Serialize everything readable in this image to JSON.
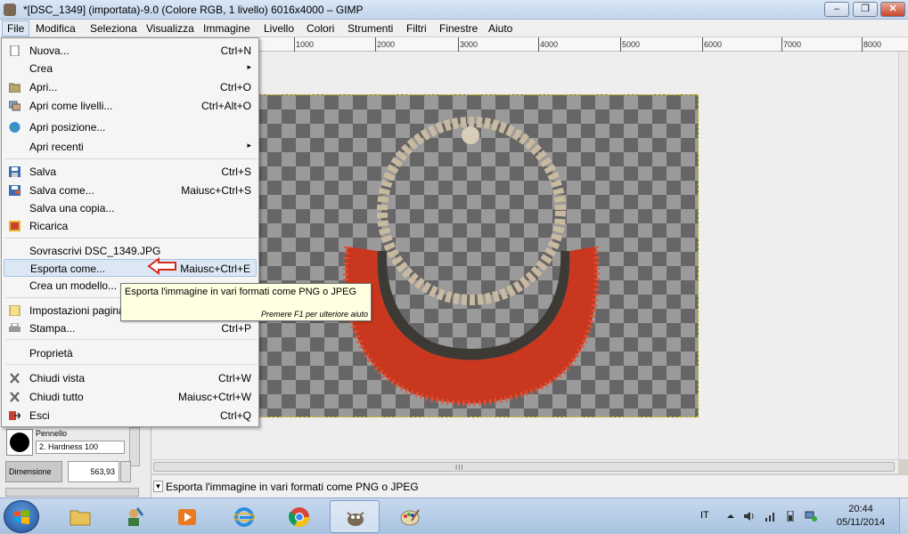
{
  "window": {
    "title": "*[DSC_1349] (importata)-9.0 (Colore RGB, 1 livello) 6016x4000 – GIMP",
    "minimize": "–",
    "maximize": "❐",
    "close": "✕"
  },
  "menubar": [
    "File",
    "Modifica",
    "Seleziona",
    "Visualizza",
    "Immagine",
    "Livello",
    "Colori",
    "Strumenti",
    "Filtri",
    "Finestre",
    "Aiuto"
  ],
  "ruler": [
    "1000",
    "2000",
    "3000",
    "4000",
    "5000",
    "6000",
    "7000",
    "8000"
  ],
  "file_menu": {
    "items": [
      {
        "label": "Nuova...",
        "shortcut": "Ctrl+N",
        "icon": "new-file-icon"
      },
      {
        "label": "Crea",
        "shortcut": "▸",
        "icon": ""
      },
      {
        "label": "Apri...",
        "shortcut": "Ctrl+O",
        "icon": "open-folder-icon"
      },
      {
        "label": "Apri come livelli...",
        "shortcut": "Ctrl+Alt+O",
        "icon": "layers-icon"
      },
      {
        "label": "Apri posizione...",
        "shortcut": "",
        "icon": "globe-icon"
      },
      {
        "label": "Apri recenti",
        "shortcut": "▸",
        "icon": ""
      },
      {
        "label": "Salva",
        "shortcut": "Ctrl+S",
        "icon": "save-icon"
      },
      {
        "label": "Salva come...",
        "shortcut": "Maiusc+Ctrl+S",
        "icon": "save-as-icon"
      },
      {
        "label": "Salva una copia...",
        "shortcut": "",
        "icon": ""
      },
      {
        "label": "Ricarica",
        "shortcut": "",
        "icon": "revert-icon"
      },
      {
        "label": "Sovrascrivi DSC_1349.JPG",
        "shortcut": "",
        "icon": ""
      },
      {
        "label": "Esporta come...",
        "shortcut": "Maiusc+Ctrl+E",
        "icon": ""
      },
      {
        "label": "Crea un modello...",
        "shortcut": "",
        "icon": ""
      },
      {
        "label": "Impostazioni pagina",
        "shortcut": "",
        "icon": "page-setup-icon"
      },
      {
        "label": "Stampa...",
        "shortcut": "Ctrl+P",
        "icon": "print-icon"
      },
      {
        "label": "Proprietà",
        "shortcut": "",
        "icon": ""
      },
      {
        "label": "Chiudi vista",
        "shortcut": "Ctrl+W",
        "icon": "close-x-icon"
      },
      {
        "label": "Chiudi tutto",
        "shortcut": "Maiusc+Ctrl+W",
        "icon": "close-x-icon"
      },
      {
        "label": "Esci",
        "shortcut": "Ctrl+Q",
        "icon": "quit-icon"
      }
    ]
  },
  "tooltip": {
    "main": "Esporta l'immagine in vari formati come PNG o JPEG",
    "hint": "Premere F1 per ulteriore aiuto"
  },
  "statusbar": {
    "message": "Esporta l'immagine in vari formati come PNG o JPEG"
  },
  "dock": {
    "brush_label": "Pennello",
    "brush_name": "2. Hardness 100",
    "size_label": "Dimensione",
    "size_value": "563,93"
  },
  "taskbar": {
    "language": "IT",
    "time": "20:44",
    "date": "05/11/2014"
  },
  "colors": {
    "annotation_arrow": "#d42a1c",
    "menu_highlight": "#dce7f5",
    "tooltip_bg": "#ffffe1"
  }
}
